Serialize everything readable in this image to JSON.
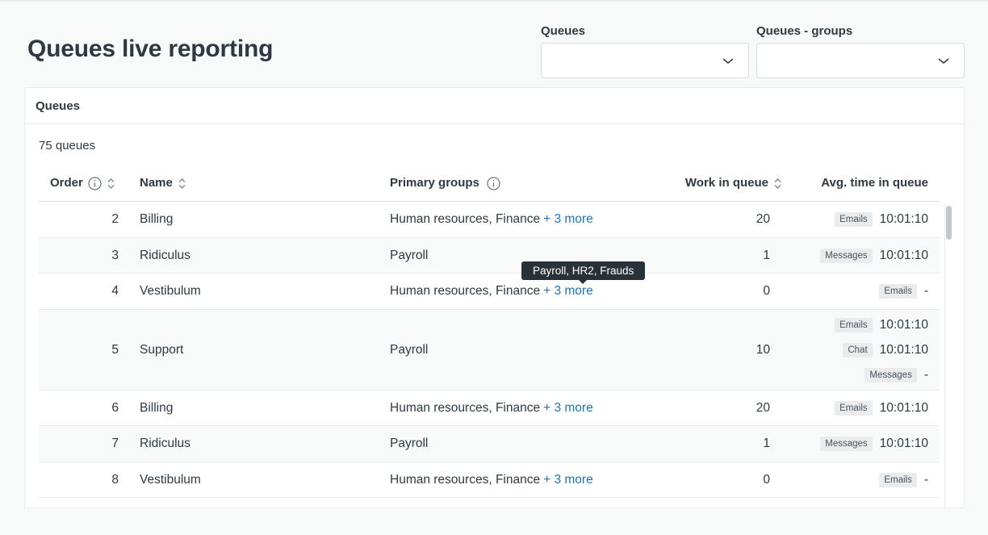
{
  "page": {
    "title": "Queues live reporting"
  },
  "filters": [
    {
      "label": "Queues",
      "value": ""
    },
    {
      "label": "Queues - groups",
      "value": ""
    }
  ],
  "card": {
    "title": "Queues",
    "count_text": "75 queues"
  },
  "table": {
    "columns": {
      "order": "Order",
      "name": "Name",
      "primary_groups": "Primary groups",
      "work_in_queue": "Work in queue",
      "avg_time": "Avg. time in queue"
    },
    "rows": [
      {
        "order": "2",
        "name": "Billing",
        "groups": "Human resources, Finance",
        "more": "+ 3 more",
        "work": "20",
        "avg": [
          {
            "channel": "Emails",
            "time": "10:01:10"
          }
        ]
      },
      {
        "order": "3",
        "name": "Ridiculus",
        "groups": "Payroll",
        "more": "",
        "work": "1",
        "avg": [
          {
            "channel": "Messages",
            "time": "10:01:10"
          }
        ]
      },
      {
        "order": "4",
        "name": "Vestibulum",
        "groups": "Human resources, Finance",
        "more": "+ 3 more",
        "work": "0",
        "avg": [
          {
            "channel": "Emails",
            "time": "-"
          }
        ]
      },
      {
        "order": "5",
        "name": "Support",
        "groups": "Payroll",
        "more": "",
        "work": "10",
        "avg": [
          {
            "channel": "Emails",
            "time": "10:01:10"
          },
          {
            "channel": "Chat",
            "time": "10:01:10"
          },
          {
            "channel": "Messages",
            "time": "-"
          }
        ]
      },
      {
        "order": "6",
        "name": "Billing",
        "groups": "Human resources, Finance",
        "more": "+ 3 more",
        "work": "20",
        "avg": [
          {
            "channel": "Emails",
            "time": "10:01:10"
          }
        ]
      },
      {
        "order": "7",
        "name": "Ridiculus",
        "groups": "Payroll",
        "more": "",
        "work": "1",
        "avg": [
          {
            "channel": "Messages",
            "time": "10:01:10"
          }
        ]
      },
      {
        "order": "8",
        "name": "Vestibulum",
        "groups": "Human resources, Finance",
        "more": "+ 3 more",
        "work": "0",
        "avg": [
          {
            "channel": "Emails",
            "time": "-"
          }
        ]
      }
    ]
  },
  "tooltip": {
    "text": "Payroll, HR2, Frauds"
  },
  "icons": {
    "info": "info-circle-icon",
    "sort": "sort-icon",
    "chevron": "chevron-down-icon"
  },
  "colors": {
    "link": "#1f73b7",
    "tooltip_bg": "#293239",
    "badge_bg": "#e9ebed"
  }
}
